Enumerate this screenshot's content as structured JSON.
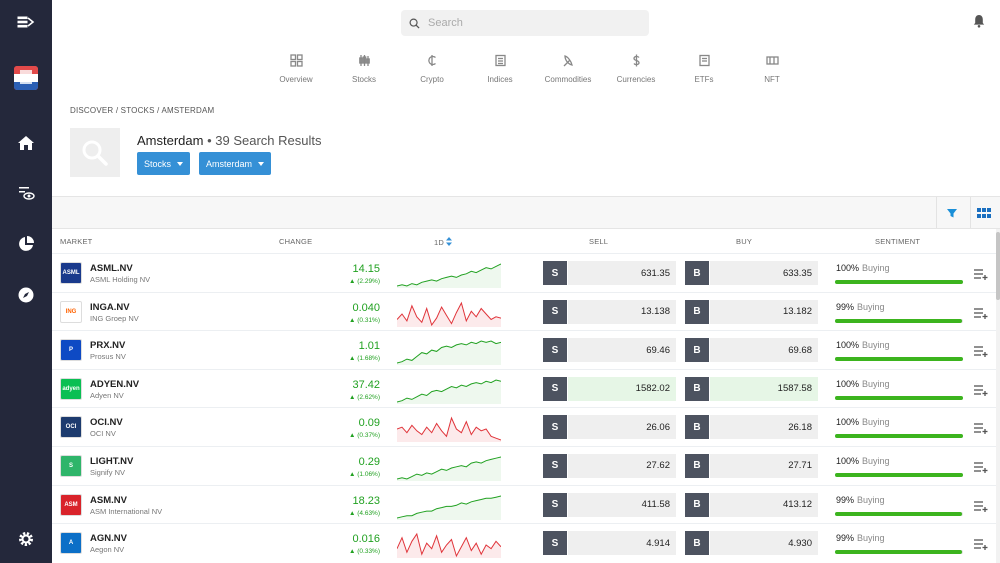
{
  "search": {
    "placeholder": "Search"
  },
  "nav": [
    {
      "label": "Overview",
      "icon": "overview-icon"
    },
    {
      "label": "Stocks",
      "icon": "stocks-icon"
    },
    {
      "label": "Crypto",
      "icon": "crypto-icon"
    },
    {
      "label": "Indices",
      "icon": "indices-icon"
    },
    {
      "label": "Commodities",
      "icon": "commodities-icon"
    },
    {
      "label": "Currencies",
      "icon": "currencies-icon"
    },
    {
      "label": "ETFs",
      "icon": "etfs-icon"
    },
    {
      "label": "NFT",
      "icon": "nft-icon"
    }
  ],
  "breadcrumb": {
    "a": "DISCOVER",
    "sep": " / ",
    "b": "STOCKS",
    "c": "AMSTERDAM"
  },
  "header": {
    "title": "Amsterdam",
    "results": "• 39 Search Results",
    "filter1": "Stocks",
    "filter2": "Amsterdam"
  },
  "columns": {
    "market": "MARKET",
    "change": "CHANGE",
    "period": "1D",
    "sell": "SELL",
    "buy": "BUY",
    "sentiment": "SENTIMENT"
  },
  "colors": {
    "green": "#21a121",
    "red": "#e0343a",
    "accent": "#3590d6",
    "sidebar": "#24283b",
    "bar": "#3cb41e"
  },
  "rows": [
    {
      "symbol": "ASML.NV",
      "name": "ASML Holding NV",
      "change": "14.15",
      "pct": "▲ (2.29%)",
      "sell": "631.35",
      "buy": "633.35",
      "sent_pct": "100%",
      "sent_label": "Buying",
      "sentiment": 100,
      "trend": "up",
      "logo_text": "ASML",
      "logo_bg": "#1a3a8c",
      "hi": false,
      "spark": [
        4,
        5,
        4,
        6,
        5,
        7,
        8,
        9,
        8,
        10,
        11,
        12,
        11,
        13,
        14,
        16,
        15,
        17,
        19,
        18,
        20,
        22
      ]
    },
    {
      "symbol": "INGA.NV",
      "name": "ING Groep NV",
      "change": "0.040",
      "pct": "▲ (0.31%)",
      "sell": "13.138",
      "buy": "13.182",
      "sent_pct": "99%",
      "sent_label": "Buying",
      "sentiment": 99,
      "trend": "down",
      "logo_text": "ING",
      "logo_bg": "#ffffff",
      "hi": false,
      "spark": [
        10,
        14,
        9,
        20,
        12,
        8,
        18,
        6,
        11,
        19,
        13,
        7,
        15,
        22,
        9,
        16,
        12,
        18,
        14,
        10,
        12,
        11
      ]
    },
    {
      "symbol": "PRX.NV",
      "name": "Prosus NV",
      "change": "1.01",
      "pct": "▲ (1.68%)",
      "sell": "69.46",
      "buy": "69.68",
      "sent_pct": "100%",
      "sent_label": "Buying",
      "sentiment": 100,
      "trend": "up",
      "logo_text": "P",
      "logo_bg": "#0e4ac4",
      "hi": false,
      "spark": [
        3,
        4,
        6,
        5,
        8,
        11,
        10,
        13,
        12,
        15,
        16,
        15,
        17,
        18,
        17,
        19,
        18,
        20,
        19,
        20,
        18,
        19
      ]
    },
    {
      "symbol": "ADYEN.NV",
      "name": "Adyen NV",
      "change": "37.42",
      "pct": "▲ (2.62%)",
      "sell": "1582.02",
      "buy": "1587.58",
      "sent_pct": "100%",
      "sent_label": "Buying",
      "sentiment": 100,
      "trend": "up",
      "logo_text": "adyen",
      "logo_bg": "#0abf53",
      "hi": true,
      "spark": [
        4,
        5,
        7,
        6,
        8,
        10,
        9,
        12,
        13,
        12,
        14,
        16,
        15,
        17,
        16,
        18,
        19,
        18,
        20,
        19,
        21,
        20
      ]
    },
    {
      "symbol": "OCI.NV",
      "name": "OCI NV",
      "change": "0.09",
      "pct": "▲ (0.37%)",
      "sell": "26.06",
      "buy": "26.18",
      "sent_pct": "100%",
      "sent_label": "Buying",
      "sentiment": 100,
      "trend": "down",
      "logo_text": "OCI",
      "logo_bg": "#1d3b6e",
      "hi": false,
      "spark": [
        14,
        15,
        12,
        16,
        13,
        11,
        15,
        12,
        17,
        13,
        10,
        20,
        14,
        12,
        18,
        11,
        15,
        13,
        14,
        10,
        9,
        8
      ]
    },
    {
      "symbol": "LIGHT.NV",
      "name": "Signify NV",
      "change": "0.29",
      "pct": "▲ (1.06%)",
      "sell": "27.62",
      "buy": "27.71",
      "sent_pct": "100%",
      "sent_label": "Buying",
      "sentiment": 100,
      "trend": "up",
      "logo_text": "S",
      "logo_bg": "#2fb56a",
      "hi": false,
      "spark": [
        4,
        5,
        4,
        6,
        8,
        7,
        9,
        8,
        10,
        12,
        11,
        13,
        14,
        15,
        14,
        17,
        18,
        17,
        19,
        20,
        21,
        22
      ]
    },
    {
      "symbol": "ASM.NV",
      "name": "ASM International NV",
      "change": "18.23",
      "pct": "▲ (4.63%)",
      "sell": "411.58",
      "buy": "413.12",
      "sent_pct": "99%",
      "sent_label": "Buying",
      "sentiment": 99,
      "trend": "up",
      "logo_text": "ASM",
      "logo_bg": "#d9232a",
      "hi": false,
      "spark": [
        3,
        4,
        5,
        5,
        7,
        8,
        9,
        9,
        11,
        12,
        13,
        13,
        14,
        16,
        15,
        17,
        18,
        19,
        20,
        20,
        21,
        22
      ]
    },
    {
      "symbol": "AGN.NV",
      "name": "Aegon NV",
      "change": "0.016",
      "pct": "▲ (0.33%)",
      "sell": "4.914",
      "buy": "4.930",
      "sent_pct": "99%",
      "sent_label": "Buying",
      "sentiment": 99,
      "trend": "down",
      "logo_text": "A",
      "logo_bg": "#0c6fc7",
      "hi": false,
      "spark": [
        12,
        18,
        10,
        16,
        20,
        9,
        15,
        12,
        19,
        10,
        14,
        17,
        8,
        13,
        18,
        11,
        15,
        9,
        14,
        12,
        16,
        13
      ]
    }
  ]
}
